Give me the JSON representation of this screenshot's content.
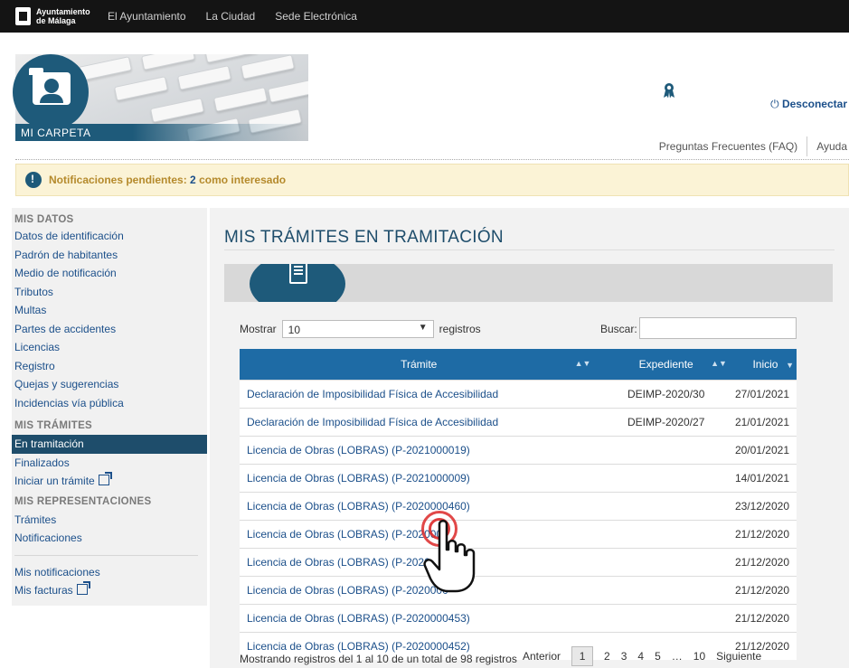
{
  "topbar": {
    "brand_line1": "Ayuntamiento",
    "brand_line2": "de Málaga",
    "nav": [
      "El Ayuntamiento",
      "La Ciudad",
      "Sede Electrónica"
    ]
  },
  "header": {
    "section_label": "MI CARPETA",
    "logout_label": "Desconectar",
    "faq_label": "Preguntas Frecuentes (FAQ)",
    "help_label": "Ayuda"
  },
  "notification": {
    "prefix": "Notificaciones pendientes:",
    "count": "2",
    "suffix": "como interesado"
  },
  "sidebar": {
    "mis_datos_title": "MIS DATOS",
    "mis_datos": [
      "Datos de identificación",
      "Padrón de habitantes",
      "Medio de notificación",
      "Tributos",
      "Multas",
      "Partes de accidentes",
      "Licencias",
      "Registro",
      "Quejas y sugerencias",
      "Incidencias vía pública"
    ],
    "mis_tramites_title": "MIS TRÁMITES",
    "mis_tramites": [
      "En tramitación",
      "Finalizados",
      "Iniciar un trámite"
    ],
    "mis_representaciones_title": "MIS REPRESENTACIONES",
    "mis_representaciones": [
      "Trámites",
      "Notificaciones"
    ],
    "extra": [
      "Mis notificaciones",
      "Mis facturas"
    ]
  },
  "main": {
    "title": "MIS TRÁMITES EN TRAMITACIÓN",
    "show_label": "Mostrar",
    "show_value": "10",
    "records_label": "registros",
    "search_label": "Buscar:",
    "search_value": "",
    "columns": [
      "Trámite",
      "Expediente",
      "Inicio"
    ],
    "rows": [
      {
        "tramite": "Declaración de Imposibilidad Física de Accesibilidad",
        "expediente": "DEIMP-2020/30",
        "inicio": "27/01/2021"
      },
      {
        "tramite": "Declaración de Imposibilidad Física de Accesibilidad",
        "expediente": "DEIMP-2020/27",
        "inicio": "21/01/2021"
      },
      {
        "tramite": "Licencia de Obras (LOBRAS) (P-2021000019)",
        "expediente": "",
        "inicio": "20/01/2021"
      },
      {
        "tramite": "Licencia de Obras (LOBRAS) (P-2021000009)",
        "expediente": "",
        "inicio": "14/01/2021"
      },
      {
        "tramite": "Licencia de Obras (LOBRAS) (P-2020000460)",
        "expediente": "",
        "inicio": "23/12/2020"
      },
      {
        "tramite": "Licencia de Obras (LOBRAS) (P-2020000",
        "expediente": "",
        "inicio": "21/12/2020"
      },
      {
        "tramite": "Licencia de Obras (LOBRAS) (P-2020",
        "expediente": "",
        "inicio": "21/12/2020"
      },
      {
        "tramite": "Licencia de Obras (LOBRAS) (P-2020000",
        "expediente": "",
        "inicio": "21/12/2020"
      },
      {
        "tramite": "Licencia de Obras (LOBRAS) (P-2020000453)",
        "expediente": "",
        "inicio": "21/12/2020"
      },
      {
        "tramite": "Licencia de Obras (LOBRAS) (P-2020000452)",
        "expediente": "",
        "inicio": "21/12/2020"
      }
    ],
    "info": "Mostrando registros del 1 al 10 de un total de 98 registros",
    "pager": {
      "prev": "Anterior",
      "pages": [
        "1",
        "2",
        "3",
        "4",
        "5",
        "…",
        "10"
      ],
      "next": "Siguiente"
    }
  },
  "colors": {
    "accent": "#1e5a7a",
    "table_header": "#1e6ba5",
    "link": "#1b4f8a"
  },
  "icons": [
    "award-icon",
    "power-icon",
    "warning-icon",
    "document-icon",
    "external-link-icon",
    "hand-pointer-icon"
  ]
}
